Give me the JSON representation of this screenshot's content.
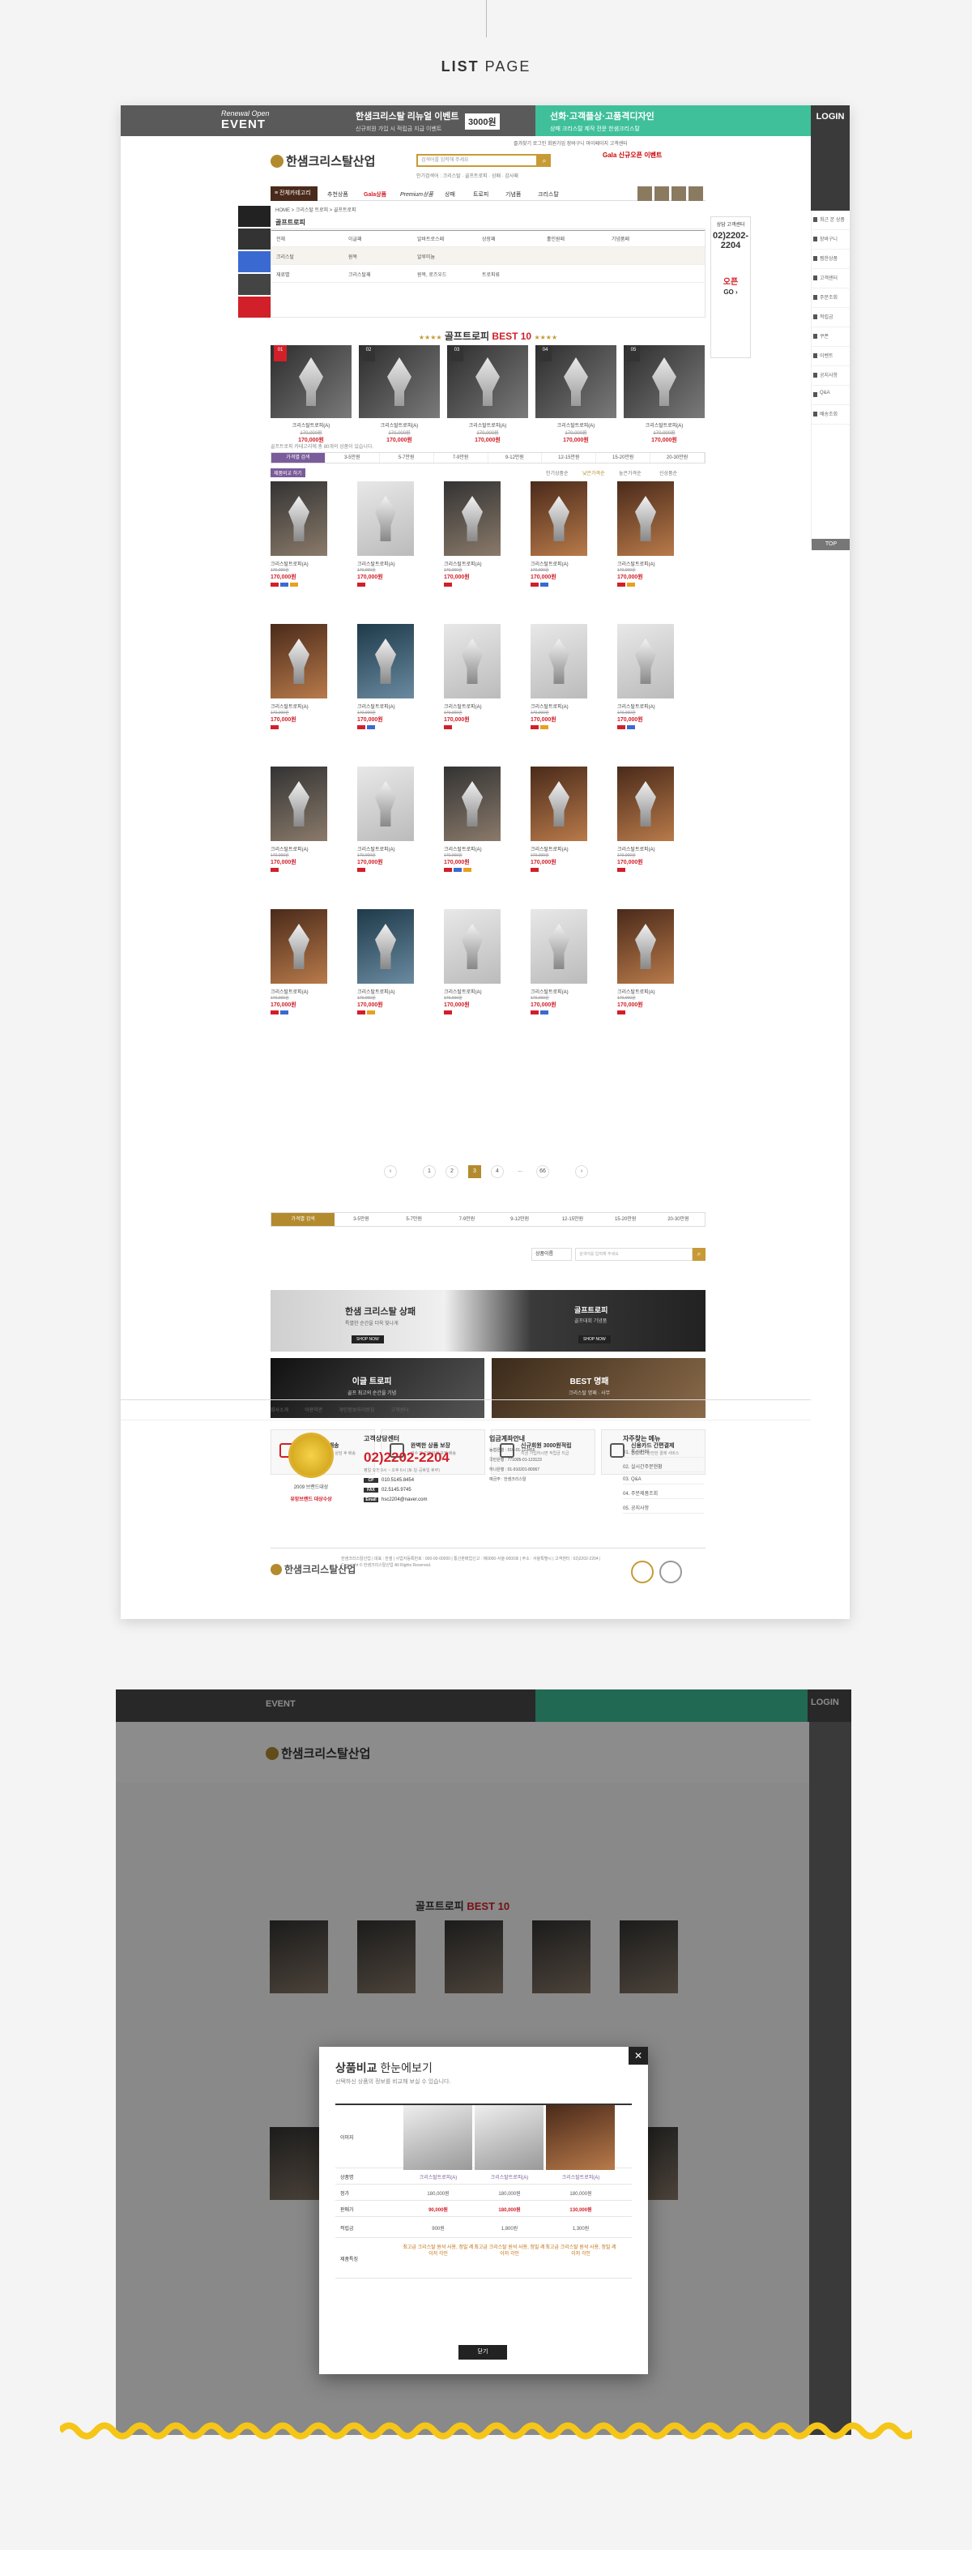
{
  "page_heading": {
    "bold": "LIST",
    "light": "PAGE"
  },
  "top_banner": {
    "event_small": "Renewal Open",
    "event_big": "EVENT",
    "message": "한샘크리스탈 리뉴얼 이벤트",
    "message_sub": "신규회원 가입 시 적립금 지급 이벤트",
    "amount": "3000원",
    "right_text": "선화·고객플상·고품격디자인",
    "right_sub": "상패 크리스탈 제작 전문 한샘크리스탈",
    "login_label": "LOGIN"
  },
  "header": {
    "logo_text": "한샘크리스탈산업",
    "search_placeholder": "검색어를 입력해 주세요",
    "search_icon": "magnifier",
    "util_links": "즐겨찾기  로그인  회원가입  장바구니  마이페이지  고객센터",
    "hot_links": "인기검색어 : 크리스탈 · 골프트로피 · 상패 · 감사패",
    "right_promo": "Gala 신규오픈 이벤트"
  },
  "nav": {
    "all_category": "전체카테고리",
    "items": [
      "추천상품",
      "Gala상품",
      "Premium상품",
      "상패",
      "트로피",
      "기념품",
      "크리스탈"
    ]
  },
  "right_sidebar": {
    "items": [
      "최근 본 상품",
      "장바구니",
      "찜한상품",
      "고객센터",
      "주문조회",
      "적립금",
      "쿠폰",
      "이벤트",
      "공지사항",
      "Q&A",
      "배송조회"
    ],
    "top_label": "TOP"
  },
  "breadcrumb": "HOME  >  크리스탈 트로피  >  골프트로피",
  "category_title": "골프트로피",
  "filter_rows": [
    [
      "전체",
      "이글패",
      "알바트로스패",
      "상장패",
      "홀인원패",
      "기념품패"
    ],
    [
      "크리스탈",
      "원목",
      "알루미늄",
      "",
      "",
      ""
    ],
    [
      "재료별",
      "크리스탈패",
      "원목, 로즈우드",
      "트로피류",
      "",
      ""
    ]
  ],
  "best": {
    "title_main": "골프트로피",
    "title_accent": "BEST 10",
    "stars": "★★★★",
    "items": [
      {
        "rank": "01",
        "name": "크리스탈트로피(A)",
        "price": "170,000원",
        "sale": "170,000원"
      },
      {
        "rank": "02",
        "name": "크리스탈트로피(A)",
        "price": "170,000원",
        "sale": "170,000원"
      },
      {
        "rank": "03",
        "name": "크리스탈트로피(A)",
        "price": "170,000원",
        "sale": "170,000원"
      },
      {
        "rank": "04",
        "name": "크리스탈트로피(A)",
        "price": "170,000원",
        "sale": "170,000원"
      },
      {
        "rank": "05",
        "name": "크리스탈트로피(A)",
        "price": "170,000원",
        "sale": "170,000원"
      }
    ]
  },
  "category_note": "골프트로피 카테고리에 총 80개의 상품이 있습니다.",
  "price_tabs": [
    "가격별 검색",
    "3-5만원",
    "5-7만원",
    "7-9만원",
    "9-12만원",
    "12-15만원",
    "15-20만원",
    "20-30만원"
  ],
  "sort": {
    "badge": "제품비교 하기",
    "options": [
      "인기상품순",
      "낮은가격순",
      "높은가격순",
      "신상품순"
    ]
  },
  "products": [
    {
      "name": "크리스탈트로피(A)",
      "old": "170,000원",
      "price": "170,000원",
      "style": "dk"
    },
    {
      "name": "크리스탈트로피(A)",
      "old": "170,000원",
      "price": "170,000원",
      "style": "lt"
    },
    {
      "name": "크리스탈트로피(A)",
      "old": "170,000원",
      "price": "170,000원",
      "style": "dk"
    },
    {
      "name": "크리스탈트로피(A)",
      "old": "170,000원",
      "price": "170,000원",
      "style": "br"
    },
    {
      "name": "크리스탈트로피(A)",
      "old": "170,000원",
      "price": "170,000원",
      "style": "br"
    },
    {
      "name": "크리스탈트로피(A)",
      "old": "170,000원",
      "price": "170,000원",
      "style": "br"
    },
    {
      "name": "크리스탈트로피(A)",
      "old": "170,000원",
      "price": "170,000원",
      "style": "gr"
    },
    {
      "name": "크리스탈트로피(A)",
      "old": "170,000원",
      "price": "170,000원",
      "style": "lt"
    },
    {
      "name": "크리스탈트로피(A)",
      "old": "170,000원",
      "price": "170,000원",
      "style": "lt"
    },
    {
      "name": "크리스탈트로피(A)",
      "old": "170,000원",
      "price": "170,000원",
      "style": "lt"
    },
    {
      "name": "크리스탈트로피(A)",
      "old": "170,000원",
      "price": "170,000원",
      "style": "dk"
    },
    {
      "name": "크리스탈트로피(A)",
      "old": "170,000원",
      "price": "170,000원",
      "style": "lt"
    },
    {
      "name": "크리스탈트로피(A)",
      "old": "170,000원",
      "price": "170,000원",
      "style": "dk"
    },
    {
      "name": "크리스탈트로피(A)",
      "old": "170,000원",
      "price": "170,000원",
      "style": "br"
    },
    {
      "name": "크리스탈트로피(A)",
      "old": "170,000원",
      "price": "170,000원",
      "style": "br"
    },
    {
      "name": "크리스탈트로피(A)",
      "old": "170,000원",
      "price": "170,000원",
      "style": "br"
    },
    {
      "name": "크리스탈트로피(A)",
      "old": "170,000원",
      "price": "170,000원",
      "style": "gr"
    },
    {
      "name": "크리스탈트로피(A)",
      "old": "170,000원",
      "price": "170,000원",
      "style": "lt"
    },
    {
      "name": "크리스탈트로피(A)",
      "old": "170,000원",
      "price": "170,000원",
      "style": "lt"
    },
    {
      "name": "크리스탈트로피(A)",
      "old": "170,000원",
      "price": "170,000원",
      "style": "br"
    }
  ],
  "pager": {
    "prev": "‹",
    "pages": [
      "1",
      "2",
      "3",
      "4",
      "...",
      "66"
    ],
    "current": "3",
    "next": "›"
  },
  "bottom_price_tabs": [
    "가격별 검색",
    "3-5만원",
    "5-7만원",
    "7-9만원",
    "9-12만원",
    "12-15만원",
    "15-20만원",
    "20-30만원"
  ],
  "bottom_search": {
    "select": "상품이름",
    "placeholder": "검색어를 입력해 주세요",
    "icon": "magnifier"
  },
  "banner_big": {
    "left_title": "한샘 크리스탈 상패",
    "left_sub": "특별한 순간을 더욱 빛나게",
    "right_title": "골프트로피",
    "right_sub": "골프대회 기념품",
    "shop_now": "SHOP NOW"
  },
  "banner_small": [
    {
      "title": "이글 트로피",
      "sub": "골프 최고의 순간을 기념"
    },
    {
      "title": "BEST 명패",
      "sub": "크리스탈 명패 · 사무"
    }
  ],
  "features": [
    {
      "icon": "cart-icon",
      "title": "간편주문 & 배송",
      "sub": "쉽고 빠른 주문 제작 상담 후 배송"
    },
    {
      "icon": "check-icon",
      "title": "완벽한 상품 보장",
      "sub": "검수 후 안전하게 포장 배송"
    },
    {
      "icon": "user-icon",
      "title": "신규회원 3000원적립",
      "sub": "지금 가입하시면 적립금 지급"
    },
    {
      "icon": "card-icon",
      "title": "신용카드 간편결제",
      "sub": "간편하고 안전한 결제 서비스"
    }
  ],
  "footer_nav": [
    "회사소개",
    "이용약관",
    "개인정보처리방침",
    "고객센터"
  ],
  "award": {
    "line1": "2009 브랜드대상",
    "line2": "유망브랜드 대상수상"
  },
  "cs": {
    "title": "고객상담센터",
    "phone": "02)2202-2204",
    "hours": "평일 오전 9시 ~ 오후 6시 (토·일·공휴일 휴무)",
    "rows": [
      {
        "tag": "CP",
        "value": "010.5145.8454"
      },
      {
        "tag": "FAX",
        "value": "02.5145.9745"
      },
      {
        "tag": "Email",
        "value": "hsc2204@naver.com"
      }
    ]
  },
  "bank": {
    "title": "입금계좌안내",
    "rows": [
      "농협은행 : 010-01-123456",
      "국민은행 : 771005-01-123123",
      "하나은행 : 01-910201-80067",
      "예금주 : 한샘크리스탈"
    ]
  },
  "faq": {
    "title": "자주찾는 메뉴",
    "items": [
      "01. 통신판매",
      "02. 실시간주문현황",
      "03. Q&A",
      "04. 주문제품조회",
      "05. 공지사항"
    ]
  },
  "footer_info": "한샘크리스탈산업 | 대표 : 한샘 | 사업자등록번호 : 000-00-00000 | 통신판매업신고 : 제0000-서울-0000호 | 주소 : 서울특별시 | 고객센터 : 02)2202-2204 | Copyright © 한샘크리스탈산업 All Rights Reserved.",
  "modal": {
    "title_main": "상품비교",
    "title_rest": "한눈에보기",
    "subtitle": "선택하신 상품의 정보를 비교해 보실 수 있습니다.",
    "row_labels": [
      "이미지",
      "상품명",
      "정가",
      "판매가",
      "적립금",
      "제품특징"
    ],
    "products": [
      {
        "name": "크리스탈트로피(A)",
        "list": "180,000원",
        "price": "90,000원",
        "point": "900원"
      },
      {
        "name": "크리스탈트로피(A)",
        "list": "180,000원",
        "price": "180,000원",
        "point": "1,800원"
      },
      {
        "name": "크리스탈트로피(A)",
        "list": "180,000원",
        "price": "130,000원",
        "point": "1,300원"
      }
    ],
    "feature_text": "최고급 크리스탈 원석 사용, 정밀 레이저 각인",
    "close_label": "닫기",
    "x_label": "✕"
  },
  "colors": {
    "gold": "#b38b2e",
    "red": "#d1202a",
    "green": "#3fc09a",
    "purple": "#7a5c9a",
    "wave": "#f5c518"
  }
}
